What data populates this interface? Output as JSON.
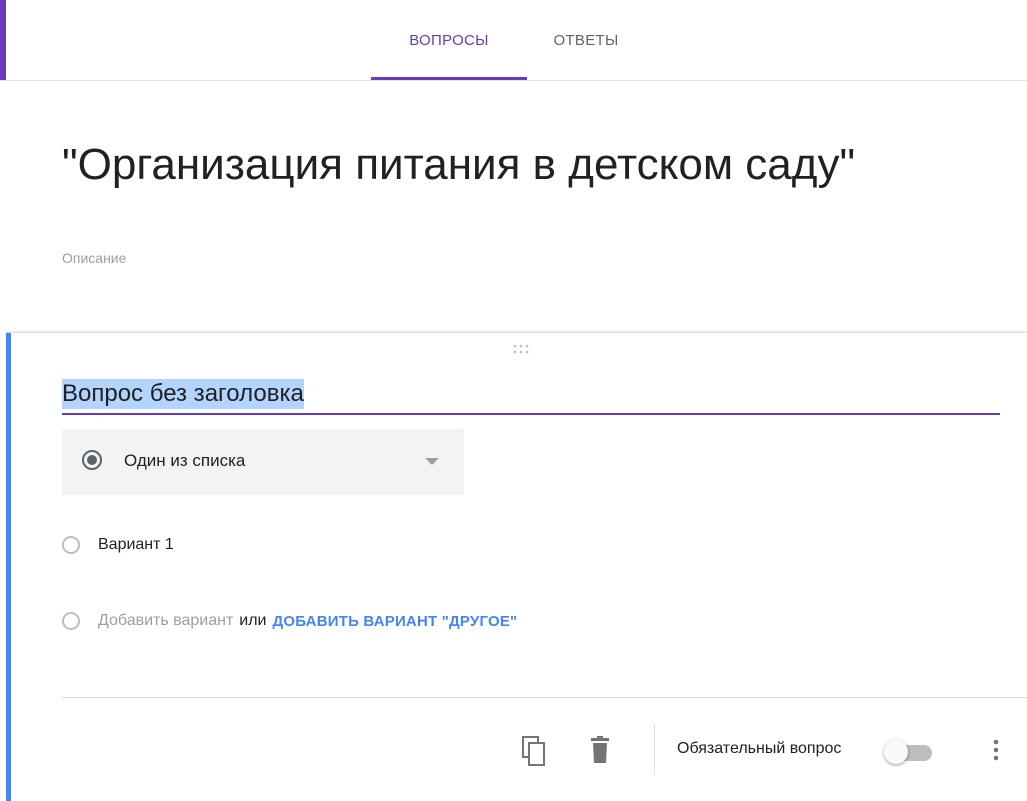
{
  "tabs": [
    {
      "label": "ВОПРОСЫ",
      "active": true
    },
    {
      "label": "ОТВЕТЫ",
      "active": false
    }
  ],
  "form": {
    "title": "\"Организация питания в детском саду\"",
    "description_placeholder": "Описание"
  },
  "question": {
    "title": "Вопрос без заголовка",
    "type_label": "Один из списка",
    "options": [
      "Вариант 1"
    ],
    "add_option": "Добавить вариант",
    "or": "или",
    "add_other": "ДОБАВИТЬ ВАРИАНТ \"ДРУГОЕ\"",
    "required_label": "Обязательный вопрос",
    "required": false
  },
  "icons": {
    "copy": "copy-icon",
    "delete": "delete-icon",
    "more": "more-vert-icon",
    "drag": "drag-handle-icon",
    "dropdown": "chevron-down-icon"
  },
  "colors": {
    "accent": "#673ab7",
    "active_card": "#4285f4",
    "link": "#4285f4"
  }
}
